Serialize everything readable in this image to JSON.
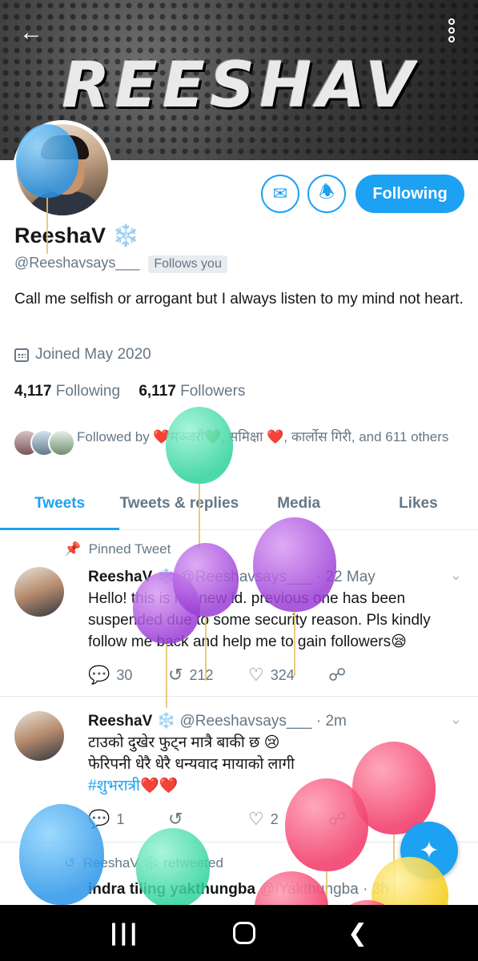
{
  "header": {
    "banner_text": "REESHAV"
  },
  "profile": {
    "name": "ReeshaV",
    "name_emoji": "❄️",
    "handle": "@Reeshavsays___",
    "follows_you": "Follows you",
    "bio": "Call me selfish or arrogant but I always listen to my mind not heart.",
    "joined": "Joined May 2020",
    "following_count": "4,117",
    "following_label": "Following",
    "followers_count": "6,117",
    "followers_label": "Followers",
    "followed_by": "Followed by ❤️मञ्जरी💚, समिक्षा ❤️, कार्लोस गिरी, and 611 others",
    "follow_button": "Following"
  },
  "tabs": [
    "Tweets",
    "Tweets & replies",
    "Media",
    "Likes"
  ],
  "tweets": [
    {
      "context": "Pinned Tweet",
      "name": "ReeshaV",
      "emoji": "❄️",
      "handle": "@Reeshavsays___",
      "time": "22 May",
      "text": "Hello! this is my new id. previous one has been suspended due to some security reason. Pls kindly follow me back and help me to gain followers😪",
      "replies": "30",
      "retweets": "212",
      "likes": "324"
    },
    {
      "name": "ReeshaV",
      "emoji": "❄️",
      "handle": "@Reeshavsays___",
      "time": "2m",
      "line1": "टाउको दुखेर फुट्न मात्रै बाकी छ 😢",
      "line2": "फेरिपनी धेरै धेरै धन्यवाद मायाको लागी",
      "hashtag": "#शुभरात्री",
      "hearts": "❤️❤️",
      "replies": "1",
      "retweets": "",
      "likes": "2"
    },
    {
      "context": "ReeshaV ❄️ retweeted",
      "name": "indra tiling yakthungba",
      "handle": "@iYakthungba",
      "time": "3h"
    }
  ],
  "colors": {
    "accent": "#1da1f2",
    "muted": "#657786"
  }
}
